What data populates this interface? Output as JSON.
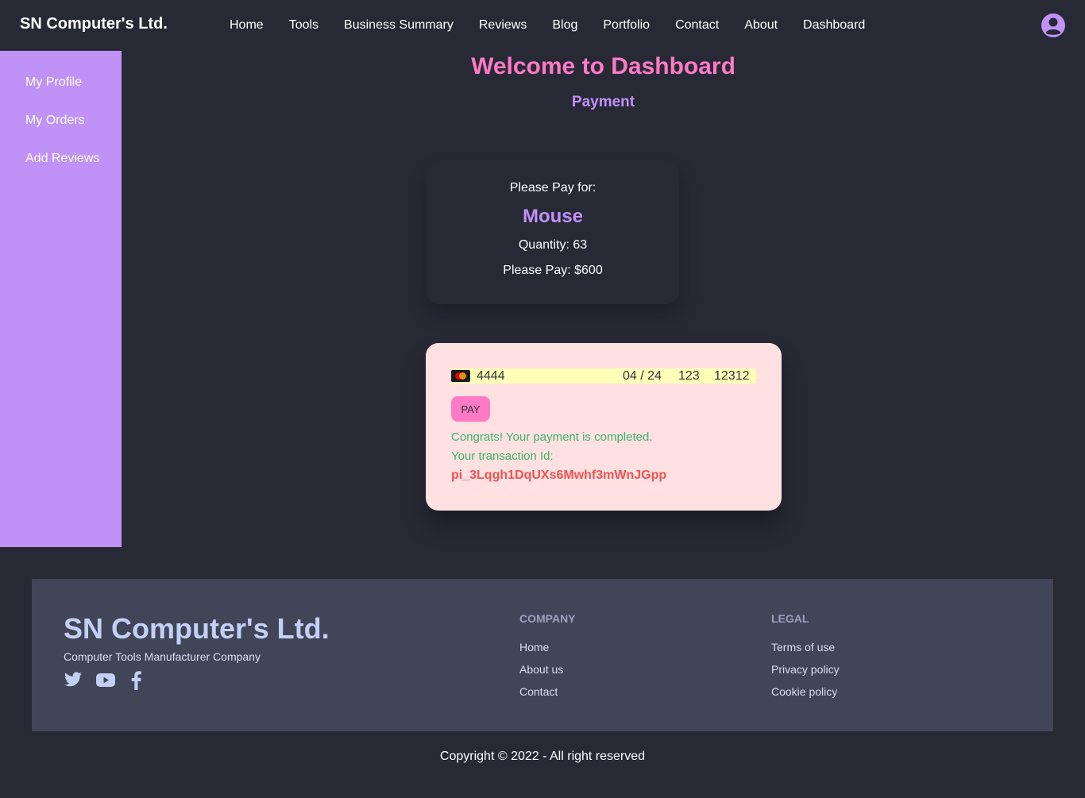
{
  "navbar": {
    "brand": "SN Computer's Ltd.",
    "links": [
      "Home",
      "Tools",
      "Business Summary",
      "Reviews",
      "Blog",
      "Portfolio",
      "Contact",
      "About",
      "Dashboard"
    ],
    "avatar_icon": "user-circle-icon"
  },
  "sidebar": {
    "items": [
      "My Profile",
      "My Orders",
      "Add Reviews"
    ]
  },
  "main": {
    "title": "Welcome to Dashboard",
    "subtitle": "Payment"
  },
  "order": {
    "label": "Please Pay for:",
    "product": "Mouse",
    "quantity_label": "Quantity:",
    "quantity": "63",
    "price_label": "Please Pay:",
    "price": "$600"
  },
  "payment": {
    "card_number": "4444",
    "expiry": "04 / 24",
    "cvc": "123",
    "zip": "12312",
    "card_brand_icon": "mastercard-icon",
    "pay_label": "PAY",
    "success_message": "Congrats! Your payment is completed.",
    "transaction_label": "Your transaction Id:",
    "transaction_id": "pi_3Lqgh1DqUXs6Mwhf3mWnJGpp"
  },
  "footer": {
    "brand": "SN Computer's Ltd.",
    "tagline": "Computer Tools Manufacturer Company",
    "socials": [
      "twitter-icon",
      "youtube-icon",
      "facebook-icon"
    ],
    "company_title": "COMPANY",
    "company_links": [
      "Home",
      "About us",
      "Contact"
    ],
    "legal_title": "LEGAL",
    "legal_links": [
      "Terms of use",
      "Privacy policy",
      "Cookie policy"
    ]
  },
  "copyright": "Copyright © 2022 - All right reserved",
  "colors": {
    "background": "#272935",
    "accent_pink": "#ff7ac6",
    "accent_purple": "#c091f7",
    "footer_bg": "#414558",
    "success": "#3bb371",
    "error": "#f05252"
  }
}
